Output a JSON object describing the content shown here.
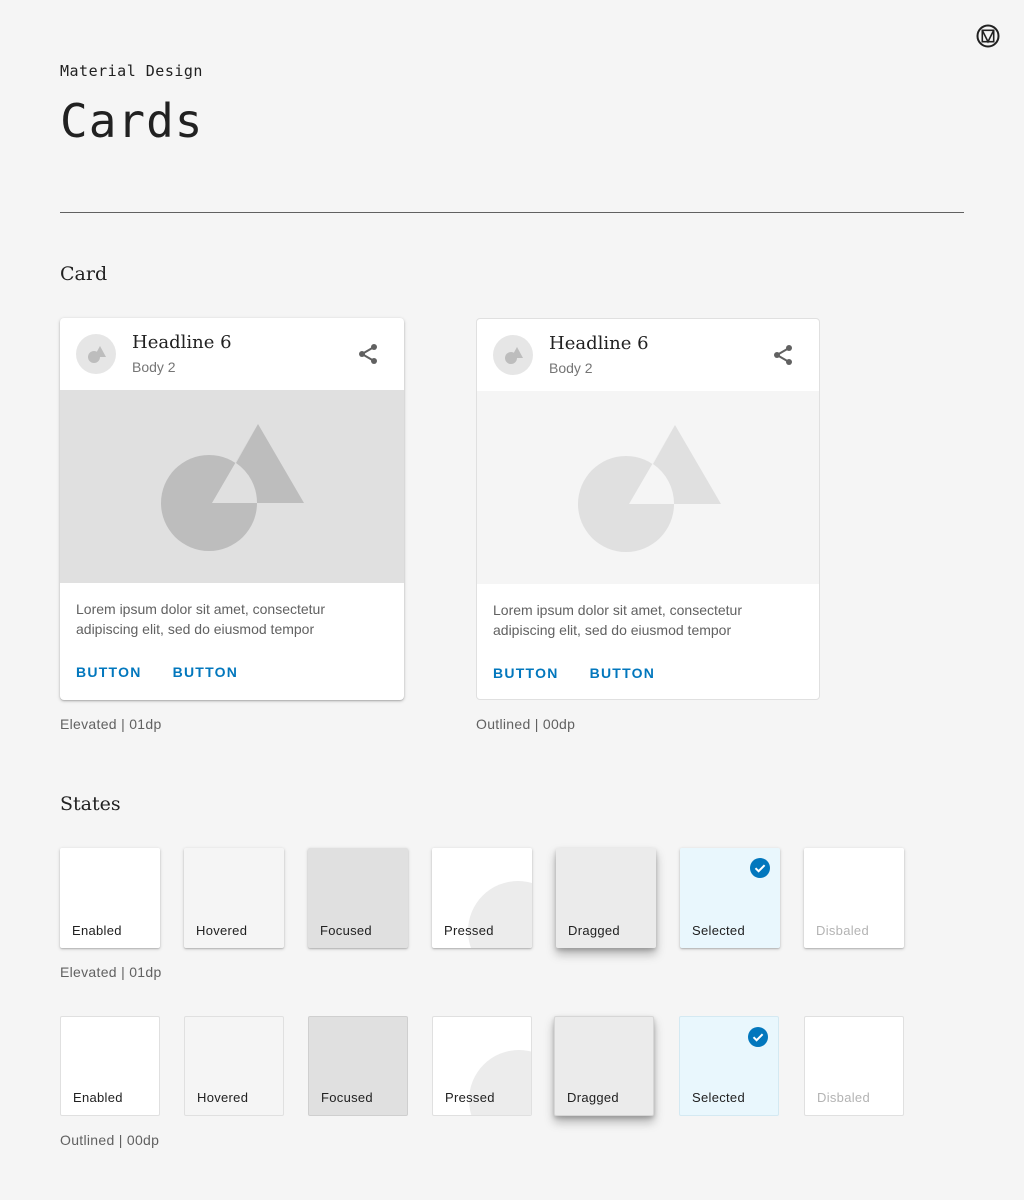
{
  "header": {
    "overline": "Material Design",
    "title": "Cards",
    "logo_icon": "material-logo-icon"
  },
  "sections": {
    "card": "Card",
    "states": "States"
  },
  "cards": [
    {
      "variant": "elevated",
      "headline": "Headline 6",
      "subhead": "Body 2",
      "body": "Lorem ipsum dolor sit amet, consectetur adipiscing elit, sed do eiusmod tempor",
      "button_1": "BUTTON",
      "button_2": "BUTTON",
      "caption": "Elevated | 01dp"
    },
    {
      "variant": "outlined",
      "headline": "Headline 6",
      "subhead": "Body 2",
      "body": "Lorem ipsum dolor sit amet, consectetur adipiscing elit, sed do eiusmod tempor",
      "button_1": "BUTTON",
      "button_2": "BUTTON",
      "caption": "Outlined | 00dp"
    }
  ],
  "states": {
    "labels": [
      "Enabled",
      "Hovered",
      "Focused",
      "Pressed",
      "Dragged",
      "Selected",
      "Disbaled"
    ],
    "elevated_caption": "Elevated | 01dp",
    "outlined_caption": "Outlined | 00dp"
  },
  "colors": {
    "background": "#f5f5f5",
    "primary": "#0277bd",
    "media_elevated": "#e0e0e0",
    "media_outlined": "#f5f5f5",
    "shape_elevated": "#bdbdbd",
    "shape_outlined": "#e0e0e0",
    "selected_bg": "#e9f7fd"
  }
}
